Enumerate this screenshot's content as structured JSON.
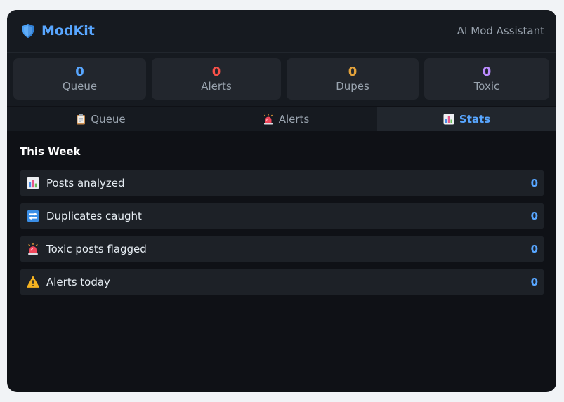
{
  "header": {
    "title": "ModKit",
    "subtitle": "AI Mod Assistant",
    "logo_icon": "shield-icon"
  },
  "stats": [
    {
      "value": "0",
      "label": "Queue",
      "color": "#58a6ff"
    },
    {
      "value": "0",
      "label": "Alerts",
      "color": "#f85149"
    },
    {
      "value": "0",
      "label": "Dupes",
      "color": "#e3a23b"
    },
    {
      "value": "0",
      "label": "Toxic",
      "color": "#bc8cff"
    }
  ],
  "tabs": [
    {
      "label": "Queue",
      "icon": "clipboard-icon",
      "active": false
    },
    {
      "label": "Alerts",
      "icon": "siren-icon",
      "active": false
    },
    {
      "label": "Stats",
      "icon": "bar-chart-icon",
      "active": true
    }
  ],
  "section": {
    "title": "This Week"
  },
  "metrics": [
    {
      "label": "Posts analyzed",
      "value": "0",
      "icon": "bar-chart-icon"
    },
    {
      "label": "Duplicates caught",
      "value": "0",
      "icon": "repeat-icon"
    },
    {
      "label": "Toxic posts flagged",
      "value": "0",
      "icon": "siren-icon"
    },
    {
      "label": "Alerts today",
      "value": "0",
      "icon": "warning-icon"
    }
  ],
  "colors": {
    "accent": "#58a6ff",
    "panel": "#0f1116"
  }
}
